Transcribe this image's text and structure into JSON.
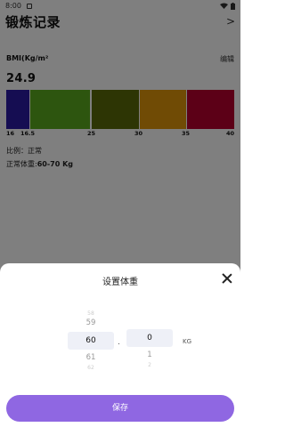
{
  "status_bar": {
    "time": "8:00"
  },
  "header": {
    "title": "锻炼记录",
    "chevron": ">"
  },
  "bmi": {
    "label": "BMI(Kg/m²",
    "edit": "编辑",
    "value": "24.9",
    "segments": [
      {
        "color": "#2a1aa5"
      },
      {
        "color": "#5aab1f"
      },
      {
        "color": "#5a6b08"
      },
      {
        "color": "#e1970b"
      },
      {
        "color": "#b8002f"
      }
    ],
    "ticks": [
      "16",
      "16.5",
      "25",
      "30",
      "35",
      "40"
    ],
    "status_text": "比例：正常",
    "normal_weight_label": "正常体重:",
    "normal_weight_value": "60-70 Kg"
  },
  "dialog": {
    "title": "设置体重",
    "integer_picker": {
      "above_far": "58",
      "above": "59",
      "selected": "60",
      "below": "61",
      "below_far": "62"
    },
    "separator": ".",
    "decimal_picker": {
      "selected": "0",
      "below": "1",
      "below_far": "2"
    },
    "unit": "KG",
    "save_label": "保存"
  }
}
